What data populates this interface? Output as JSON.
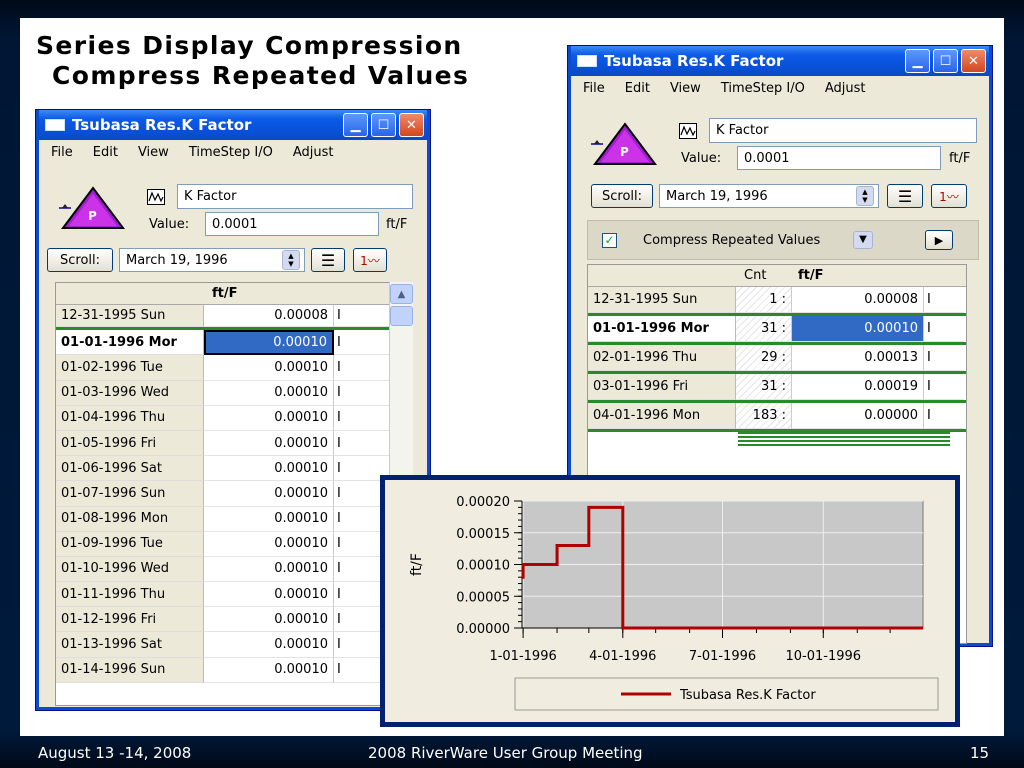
{
  "slide": {
    "title_line1": "Series Display Compression",
    "title_line2": "Compress Repeated Values",
    "footer_date": "August 13 -14, 2008",
    "footer_meeting": "2008 RiverWare User Group Meeting",
    "footer_page": "15"
  },
  "window_left": {
    "title": "Tsubasa Res.K Factor",
    "menu": [
      "File",
      "Edit",
      "View",
      "TimeStep I/O",
      "Adjust"
    ],
    "slot_name": "K Factor",
    "value_label": "Value:",
    "value": "0.0001",
    "units": "ft/F",
    "scroll_label": "Scroll:",
    "scroll_date": "March 19, 1996",
    "column_header": "ft/F",
    "rows": [
      {
        "date": "12-31-1995 Sun",
        "value": "0.00008",
        "flag": "I"
      },
      {
        "date": "01-01-1996 Mor",
        "value": "0.00010",
        "flag": "I"
      },
      {
        "date": "01-02-1996 Tue",
        "value": "0.00010",
        "flag": "I"
      },
      {
        "date": "01-03-1996 Wed",
        "value": "0.00010",
        "flag": "I"
      },
      {
        "date": "01-04-1996 Thu",
        "value": "0.00010",
        "flag": "I"
      },
      {
        "date": "01-05-1996 Fri",
        "value": "0.00010",
        "flag": "I"
      },
      {
        "date": "01-06-1996 Sat",
        "value": "0.00010",
        "flag": "I"
      },
      {
        "date": "01-07-1996 Sun",
        "value": "0.00010",
        "flag": "I"
      },
      {
        "date": "01-08-1996 Mon",
        "value": "0.00010",
        "flag": "I"
      },
      {
        "date": "01-09-1996 Tue",
        "value": "0.00010",
        "flag": "I"
      },
      {
        "date": "01-10-1996 Wed",
        "value": "0.00010",
        "flag": "I"
      },
      {
        "date": "01-11-1996 Thu",
        "value": "0.00010",
        "flag": "I"
      },
      {
        "date": "01-12-1996 Fri",
        "value": "0.00010",
        "flag": "I"
      },
      {
        "date": "01-13-1996 Sat",
        "value": "0.00010",
        "flag": "I"
      },
      {
        "date": "01-14-1996 Sun",
        "value": "0.00010",
        "flag": "I"
      }
    ]
  },
  "window_right": {
    "title": "Tsubasa Res.K Factor",
    "menu": [
      "File",
      "Edit",
      "View",
      "TimeStep I/O",
      "Adjust"
    ],
    "slot_name": "K Factor",
    "value_label": "Value:",
    "value": "0.0001",
    "units": "ft/F",
    "scroll_label": "Scroll:",
    "scroll_date": "March 19, 1996",
    "compress_label": "Compress Repeated Values",
    "cnt_header": "Cnt",
    "column_header": "ft/F",
    "rows": [
      {
        "date": "12-31-1995 Sun",
        "cnt": "1 :",
        "value": "0.00008",
        "flag": "I"
      },
      {
        "date": "01-01-1996 Mor",
        "cnt": "31 :",
        "value": "0.00010",
        "flag": "I"
      },
      {
        "date": "02-01-1996 Thu",
        "cnt": "29 :",
        "value": "0.00013",
        "flag": "I"
      },
      {
        "date": "03-01-1996 Fri",
        "cnt": "31 :",
        "value": "0.00019",
        "flag": "I"
      },
      {
        "date": "04-01-1996 Mon",
        "cnt": "183 :",
        "value": "0.00000",
        "flag": "I"
      }
    ]
  },
  "chart_data": {
    "type": "line",
    "ylabel": "ft/F",
    "xlabel": "",
    "y_ticks": [
      "0.00020",
      "0.00015",
      "0.00010",
      "0.00005",
      "0.00000"
    ],
    "x_ticks": [
      "1-01-1996",
      "4-01-1996",
      "7-01-1996",
      "10-01-1996"
    ],
    "ylim": [
      0,
      0.0002
    ],
    "xlim": [
      "1995-12-31",
      "1996-12-31"
    ],
    "series": [
      {
        "name": "Tsubasa Res.K Factor",
        "color": "#b00000",
        "x": [
          "1995-12-31",
          "1996-01-01",
          "1996-02-01",
          "1996-03-01",
          "1996-04-01",
          "1996-12-31"
        ],
        "values": [
          8e-05,
          0.0001,
          0.00013,
          0.00019,
          0.0,
          0.0
        ]
      }
    ],
    "legend": "Tsubasa Res.K Factor",
    "legend_position": "bottom",
    "grid": true
  }
}
